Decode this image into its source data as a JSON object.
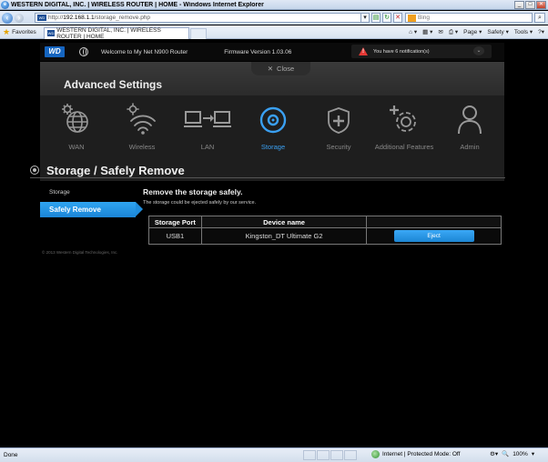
{
  "browser": {
    "window_title": "WESTERN DIGITAL, INC. | WIRELESS ROUTER | HOME - Windows Internet Explorer",
    "url_prefix": "http://",
    "url_host": "192.168.1.1",
    "url_path": "/storage_remove.php",
    "search_placeholder": "Bing",
    "favorites_label": "Favorites",
    "tab_label": "WESTERN DIGITAL, INC. | WIRELESS ROUTER | HOME",
    "commands": [
      "Page ▾",
      "Safety ▾",
      "Tools ▾"
    ],
    "status_text": "Done",
    "zone_text": "Internet | Protected Mode: Off",
    "zoom_text": "100%"
  },
  "router": {
    "logo": "WD",
    "welcome": "Welcome to My Net N900 Router",
    "firmware": "Firmware Version 1.03.06",
    "notification": "You have 6 notification(s)",
    "close_label": "Close",
    "panel_title": "Advanced Settings",
    "nav": [
      {
        "label": "WAN",
        "icon": "gear-globe-icon",
        "active": false
      },
      {
        "label": "Wireless",
        "icon": "gear-wifi-icon",
        "active": false
      },
      {
        "label": "LAN",
        "icon": "lan-computers-icon",
        "active": false
      },
      {
        "label": "Storage",
        "icon": "storage-disc-icon",
        "active": true
      },
      {
        "label": "Security",
        "icon": "shield-plus-icon",
        "active": false
      },
      {
        "label": "Additional Features",
        "icon": "gear-plus-icon",
        "active": false
      },
      {
        "label": "Admin",
        "icon": "user-icon",
        "active": false
      }
    ],
    "section_title": "Storage / Safely Remove",
    "sidebar": [
      {
        "label": "Storage",
        "active": false
      },
      {
        "label": "Safely Remove",
        "active": true
      }
    ],
    "content_title": "Remove the storage safely.",
    "content_desc": "The storage could be ejected safely by our service.",
    "table": {
      "headers": [
        "Storage Port",
        "Device name",
        ""
      ],
      "rows": [
        {
          "port": "USB1",
          "device": "Kingston_DT Ultimate G2",
          "action": "Eject"
        }
      ]
    },
    "copyright": "© 2013 Western Digital Technologies, Inc."
  },
  "colors": {
    "accent": "#2fa4f0",
    "warning": "#e53935",
    "wd_blue": "#1565c0"
  }
}
